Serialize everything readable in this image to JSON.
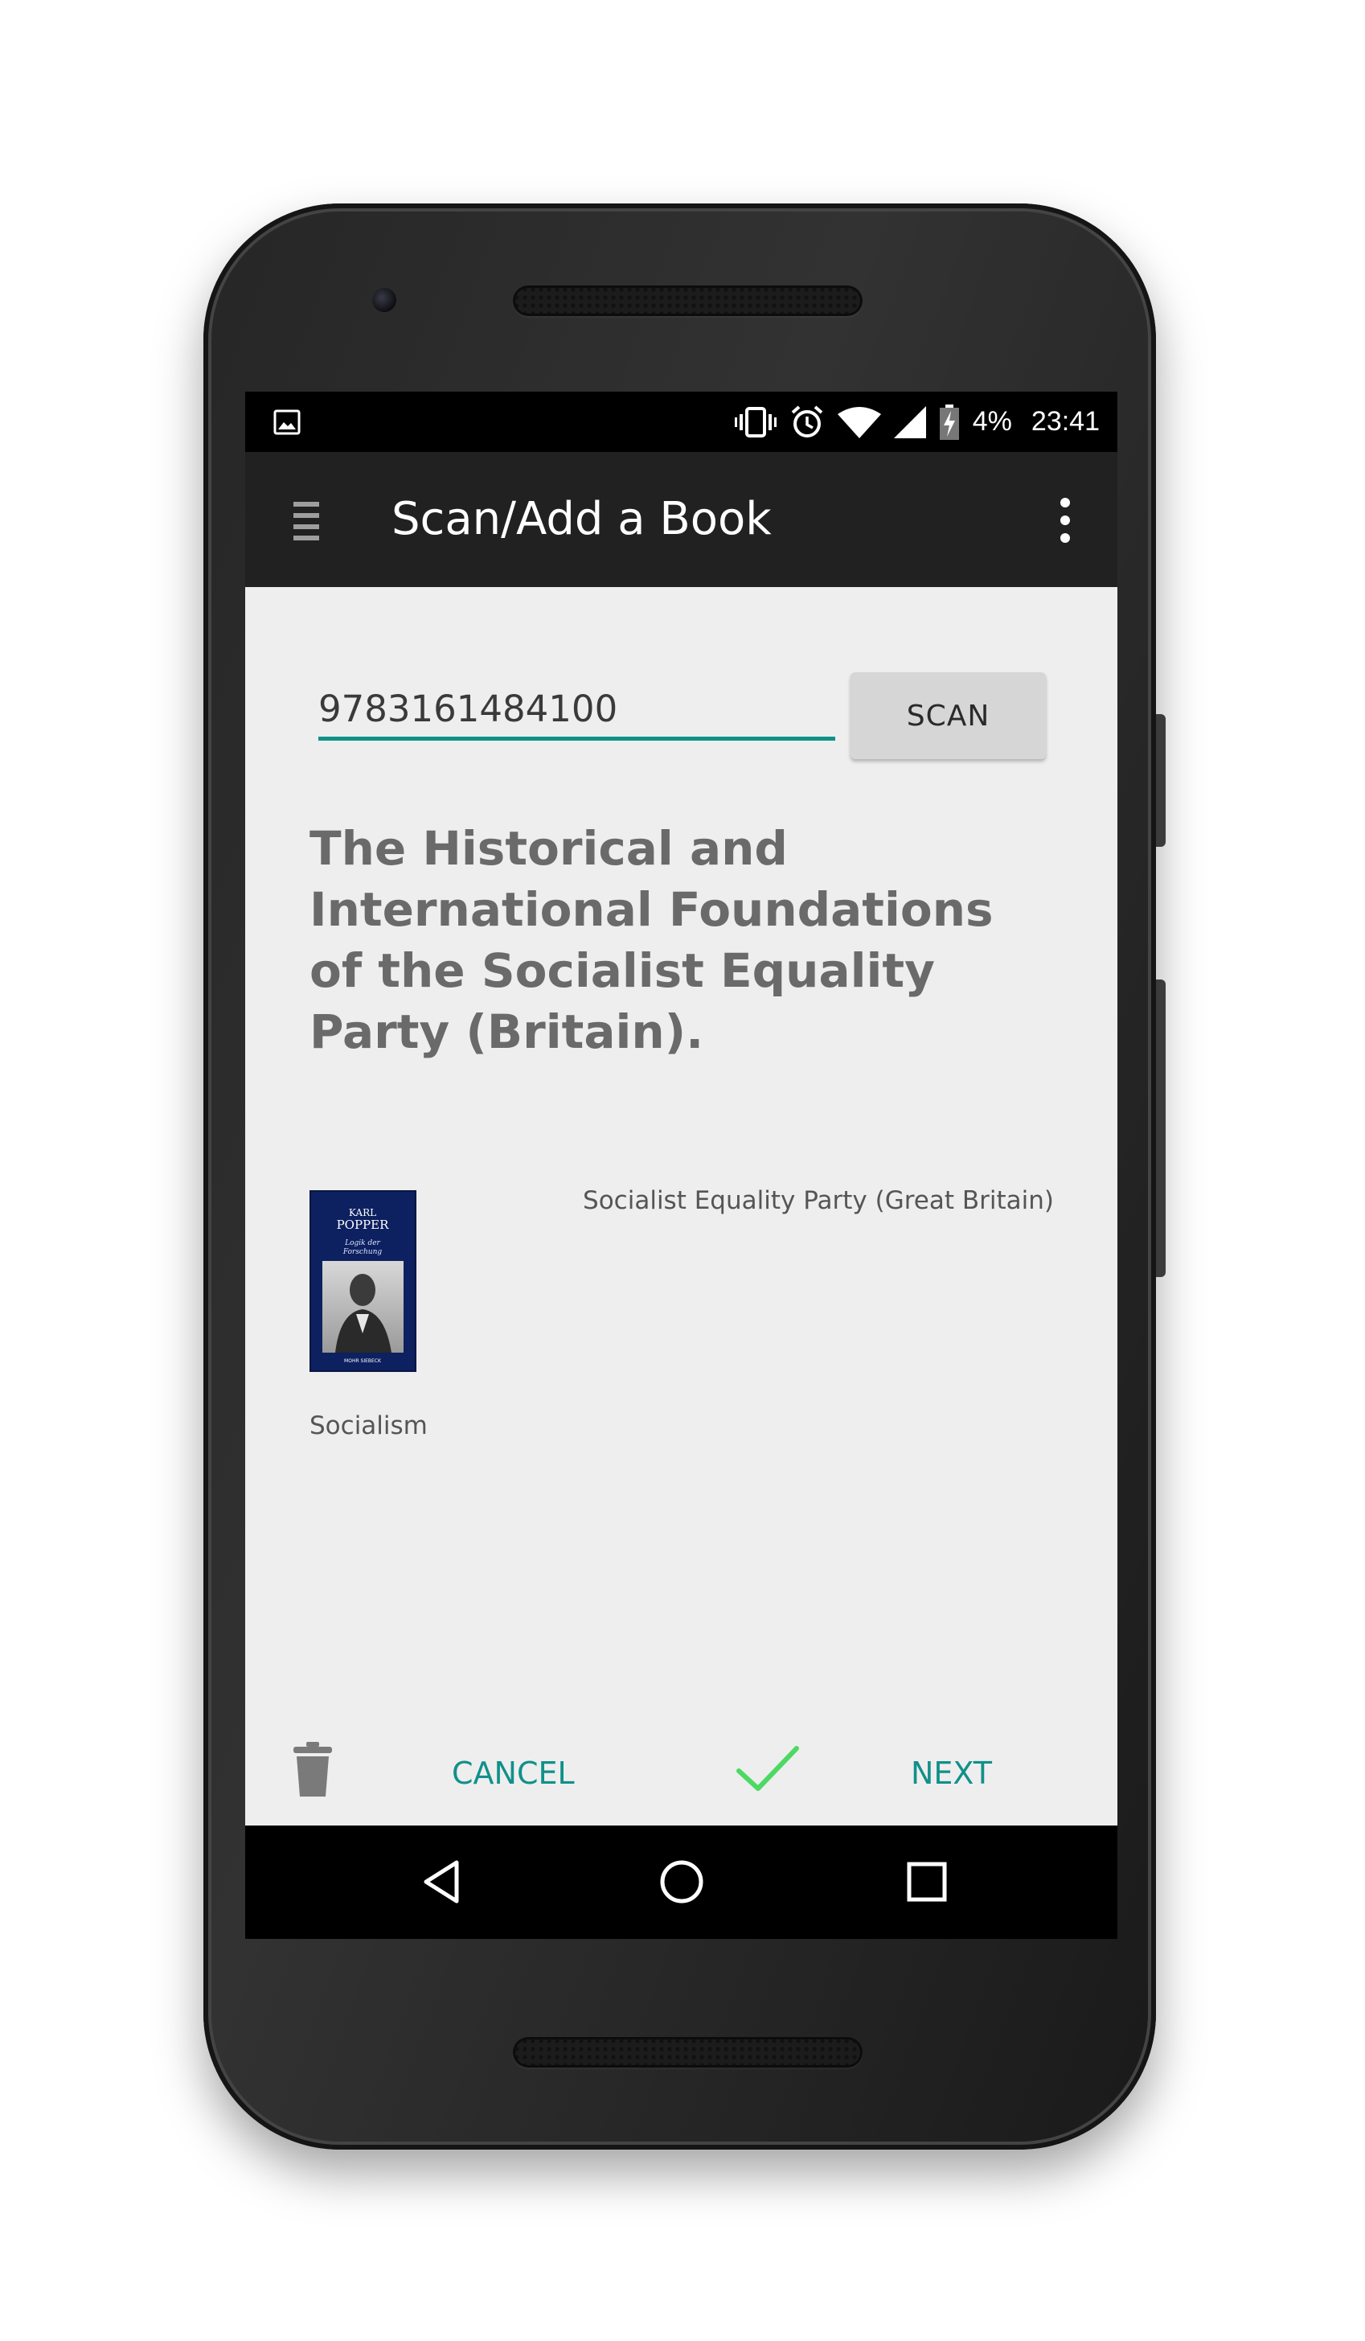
{
  "status_bar": {
    "battery": "4%",
    "time": "23:41",
    "icons": [
      "image-icon",
      "vibrate-icon",
      "alarm-icon",
      "wifi-icon",
      "signal-icon",
      "battery-charging-icon"
    ]
  },
  "toolbar": {
    "title": "Scan/Add a Book",
    "menu_icon": "hamburger-menu-icon",
    "overflow_icon": "more-vert-icon"
  },
  "form": {
    "isbn_value": "9783161484100",
    "scan_label": "SCAN"
  },
  "book": {
    "title": "The Historical and International Foundations of the Socialist Equality Party (Britain).",
    "author": "Socialist Equality Party (Great Britain)",
    "category": "Socialism",
    "cover": {
      "author_name": "KARL POPPER",
      "subtitle": "Logik der Forschung",
      "publisher": "MOHR SIEBECK"
    }
  },
  "actions": {
    "delete_icon": "trash-icon",
    "cancel_label": "CANCEL",
    "confirm_icon": "check-icon",
    "next_label": "NEXT"
  },
  "colors": {
    "accent": "#11908a",
    "toolbar": "#212121",
    "background": "#eeeeee",
    "check": "#4cd964"
  },
  "nav": {
    "icons": [
      "back-icon",
      "home-icon",
      "recents-icon"
    ]
  }
}
